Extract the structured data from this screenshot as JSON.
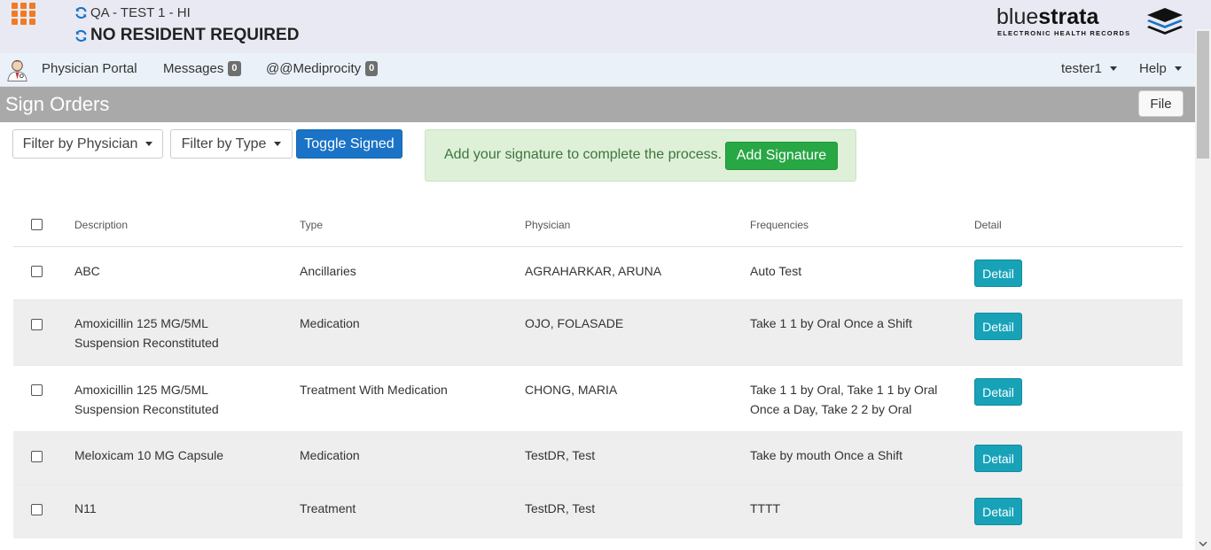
{
  "header": {
    "facility": "QA - TEST 1 - HI",
    "resident": "NO RESIDENT REQUIRED",
    "logo_brand_thin": "blue",
    "logo_brand_bold": "strata",
    "logo_subtitle": "ELECTRONIC HEALTH RECORDS",
    "accent_color": "#f07b24",
    "sync_icon_color": "#1a73c6"
  },
  "nav": {
    "portal": "Physician Portal",
    "messages_label": "Messages",
    "messages_count": "0",
    "mediprocity_label": "@@Mediprocity",
    "mediprocity_count": "0",
    "user": "tester1",
    "help": "Help"
  },
  "page": {
    "title": "Sign Orders",
    "file_button": "File"
  },
  "toolbar": {
    "filter_physician": "Filter by Physician",
    "filter_type": "Filter by Type",
    "toggle_signed": "Toggle Signed",
    "alert_text": "Add your signature to complete the process.",
    "add_signature": "Add Signature"
  },
  "table": {
    "columns": [
      "Description",
      "Type",
      "Physician",
      "Frequencies",
      "Detail"
    ],
    "rows": [
      {
        "description": [
          "ABC"
        ],
        "type": "Ancillaries",
        "physician": "AGRAHARKAR, ARUNA",
        "frequencies": [
          "Auto Test"
        ],
        "detail": "Detail"
      },
      {
        "description": [
          "Amoxicillin 125 MG/5ML",
          "Suspension Reconstituted"
        ],
        "type": "Medication",
        "physician": "OJO, FOLASADE",
        "frequencies": [
          "Take 1 1 by Oral Once a Shift"
        ],
        "detail": "Detail"
      },
      {
        "description": [
          "Amoxicillin 125 MG/5ML",
          "Suspension Reconstituted"
        ],
        "type": "Treatment With Medication",
        "physician": "CHONG, MARIA",
        "frequencies": [
          "Take 1 1 by Oral, Take 1 1 by Oral",
          "Once a Day, Take 2 2 by Oral"
        ],
        "detail": "Detail"
      },
      {
        "description": [
          "Meloxicam 10 MG Capsule"
        ],
        "type": "Medication",
        "physician": "TestDR, Test",
        "frequencies": [
          "Take by mouth Once a Shift"
        ],
        "detail": "Detail"
      },
      {
        "description": [
          "N11"
        ],
        "type": "Treatment",
        "physician": "TestDR, Test",
        "frequencies": [
          "TTTT"
        ],
        "detail": "Detail"
      }
    ]
  }
}
